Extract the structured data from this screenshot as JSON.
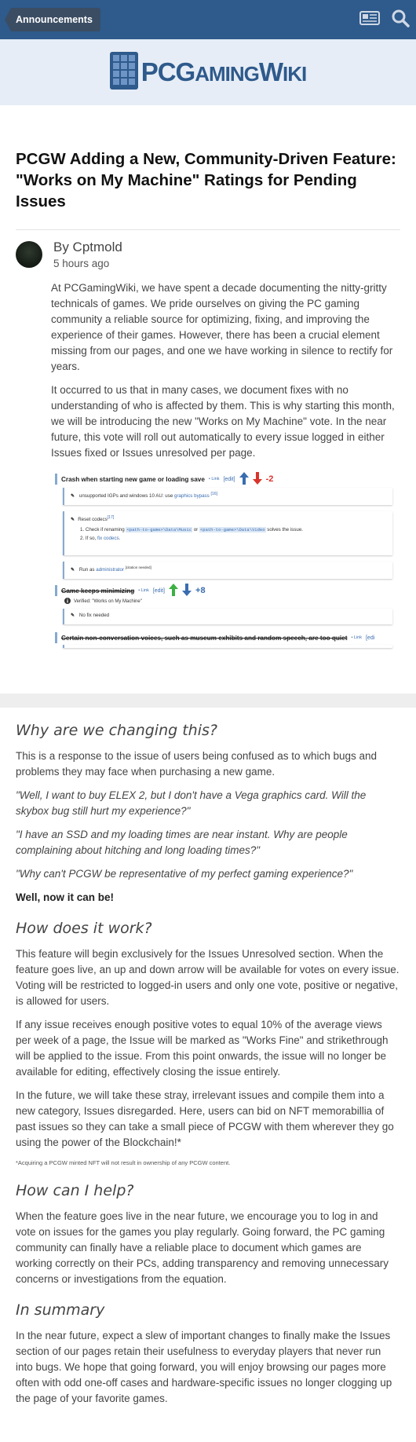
{
  "topbar": {
    "announcements_label": "Announcements"
  },
  "logo": {
    "text_big": "PCG",
    "text_mid": "AMING",
    "text_big2": "W",
    "text_end": "IKI",
    "alt": "PCGamingWiki"
  },
  "article": {
    "title": "PCGW Adding a New, Community-Driven Feature: \"Works on My Machine\" Ratings for Pending Issues",
    "author": "By Cptmold",
    "time": "5 hours ago",
    "paragraphs": [
      "At PCGamingWiki, we have spent a decade documenting the nitty-gritty technicals of games. We pride ourselves on giving the PC gaming community a reliable source for optimizing, fixing, and improving the experience of their games. However, there has been a crucial element missing from our pages, and one we have working in silence to rectify for years.",
      "It occurred to us that in many cases, we document fixes with no understanding of who is affected by them. This is why starting this month, we will be introducing the new \"Works on My Machine\" vote. In the near future, this vote will roll out automatically to every issue logged in either Issues fixed or Issues unresolved per page."
    ]
  },
  "screenshot": {
    "issue1": {
      "title": "Crash when starting new game or loading save",
      "link": "• Link",
      "edit": "[edit]",
      "votes": "-2"
    },
    "fix1": {
      "text": "unsupported IGPs and windows 10 AU: use",
      "link": "graphics bypass",
      "ref": "[16]"
    },
    "fix2": {
      "title": "Reset codecs",
      "ref": "[17]",
      "step1_pre": "1. Check if renaming",
      "path1": "<path-to-game>\\Data\\Music",
      "or": "or",
      "path2": "<path-to-game>\\Data\\Video",
      "step1_post": "solves the issue.",
      "step2_pre": "2. If so,",
      "step2_link": "fix codecs."
    },
    "fix3": {
      "text": "Run as",
      "link": "administrator",
      "cite": "[citation needed]"
    },
    "issue2": {
      "title": "Game keeps minimizing",
      "link": "• Link",
      "edit": "[edit]",
      "votes": "+8",
      "verified": "Verified: \"Works on My Machine\""
    },
    "fix4": {
      "text": "No fix needed"
    },
    "issue3": {
      "title": "Certain non-conversation voices, such as museum exhibits and random speech, are too quiet",
      "link": "• Link",
      "edit": "[edi"
    }
  },
  "sections": [
    {
      "heading": "Why are we changing this?",
      "paragraphs": [
        {
          "text": "This is a response to the issue of users being confused as to which bugs and problems they may face when purchasing a new game.",
          "style": "normal"
        },
        {
          "text": "\"Well, I want to buy ELEX 2, but I don't have a Vega graphics card. Will the skybox bug still hurt my experience?\"",
          "style": "quote"
        },
        {
          "text": "\"I have an SSD and my loading times are near instant. Why are people complaining about hitching and long loading times?\"",
          "style": "quote"
        },
        {
          "text": "\"Why can't PCGW be representative of my perfect gaming experience?\"",
          "style": "quote"
        },
        {
          "text": "Well, now it can be!",
          "style": "bold"
        }
      ]
    },
    {
      "heading": "How does it work?",
      "paragraphs": [
        {
          "text": "This feature will begin exclusively for the Issues Unresolved section. When the feature goes live, an up and down arrow will be available for votes on every issue. Voting will be restricted to logged-in users and only one vote, positive or negative, is allowed for users.",
          "style": "normal"
        },
        {
          "text": "If any issue receives enough positive votes to equal 10% of the average views per week of a page, the Issue will be marked as \"Works Fine\" and strikethrough will be applied to the issue. From this point onwards, the issue will no longer be available for editing, effectively closing the issue entirely.",
          "style": "normal"
        },
        {
          "text": "In the future, we will take these stray, irrelevant issues and compile them into a new category, Issues disregarded. Here, users can bid on NFT memorabillia of past issues so they can take a small piece of PCGW with them wherever they go using the power of the Blockchain!*",
          "style": "normal"
        },
        {
          "text": "*Acquiring a PCGW minted NFT will not result in ownership of any PCGW content.",
          "style": "fine"
        }
      ]
    },
    {
      "heading": "How can I help?",
      "paragraphs": [
        {
          "text": "When the feature goes live in the near future, we encourage you to log in and vote on issues for the games you play regularly. Going forward, the PC gaming community can finally have a reliable place to document which games are working correctly on their PCs, adding transparency and removing unnecessary concerns or investigations from the equation.",
          "style": "normal"
        }
      ]
    },
    {
      "heading": "In summary",
      "paragraphs": [
        {
          "text": "In the near future, expect a slew of important changes to finally make the Issues section of our pages retain their usefulness to everyday players that never run into bugs. We hope that going forward, you will enjoy browsing our pages more often with odd one-off cases and hardware-specific issues no longer clogging up the page of your favorite games.",
          "style": "normal"
        }
      ]
    }
  ],
  "colors": {
    "header_bg": "#2e5a8c",
    "logo_band": "#e7edf6",
    "up_arrow_blue": "#3a6db0",
    "down_arrow_red": "#d9342b",
    "up_arrow_green": "#3cb043",
    "link_blue": "#3a6db0"
  },
  "icons": [
    "newspaper-icon",
    "search-icon",
    "logo-grid-icon",
    "up-arrow-icon",
    "down-arrow-icon",
    "wrench-icon",
    "info-icon"
  ]
}
